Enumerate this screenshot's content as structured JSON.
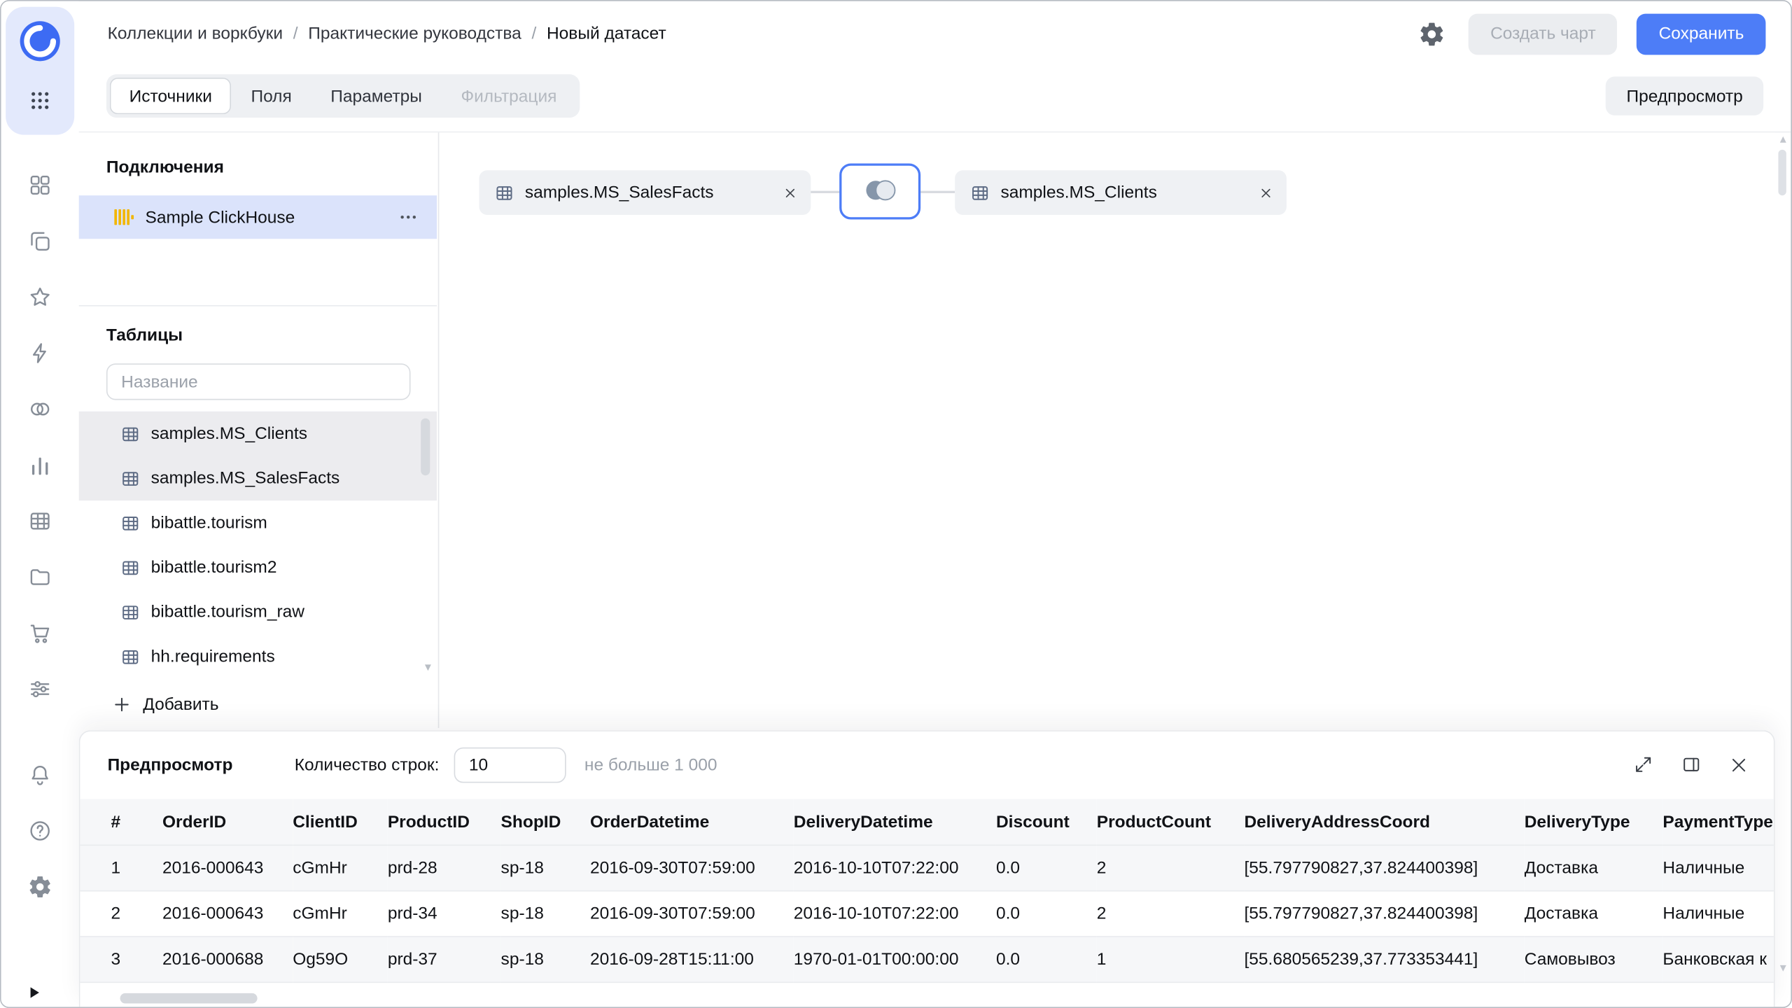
{
  "header": {
    "breadcrumb": [
      "Коллекции и воркбуки",
      "Практические руководства",
      "Новый датасет"
    ],
    "actions": {
      "create_chart": "Создать чарт",
      "save": "Сохранить"
    }
  },
  "toolbar": {
    "tabs": [
      {
        "id": "sources",
        "label": "Источники",
        "state": "active"
      },
      {
        "id": "fields",
        "label": "Поля",
        "state": "normal"
      },
      {
        "id": "parameters",
        "label": "Параметры",
        "state": "normal"
      },
      {
        "id": "filtering",
        "label": "Фильтрация",
        "state": "disabled"
      }
    ],
    "preview_toggle": "Предпросмотр"
  },
  "sidebar": {
    "icons": [
      "datalens-logo",
      "apps-grid",
      "squares",
      "layers",
      "star",
      "bolt",
      "circles",
      "chart",
      "grid",
      "folder",
      "cart",
      "sliders",
      "bell",
      "help",
      "gear",
      "collapse-play"
    ]
  },
  "connections": {
    "title": "Подключения",
    "items": [
      {
        "name": "Sample ClickHouse",
        "selected": true,
        "icon": "clickhouse"
      }
    ]
  },
  "tables": {
    "title": "Таблицы",
    "search_placeholder": "Название",
    "items": [
      {
        "name": "samples.MS_Clients",
        "selected": true
      },
      {
        "name": "samples.MS_SalesFacts",
        "selected": true
      },
      {
        "name": "bibattle.tourism",
        "selected": false
      },
      {
        "name": "bibattle.tourism2",
        "selected": false
      },
      {
        "name": "bibattle.tourism_raw",
        "selected": false
      },
      {
        "name": "hh.requirements",
        "selected": false
      }
    ],
    "add_label": "Добавить"
  },
  "canvas": {
    "nodes": [
      {
        "id": "sales-facts",
        "label": "samples.MS_SalesFacts"
      },
      {
        "id": "clients",
        "label": "samples.MS_Clients"
      }
    ],
    "join_icon": "inner-join-venn-icon"
  },
  "preview": {
    "title": "Предпросмотр",
    "row_count_label": "Количество строк:",
    "row_count_value": "10",
    "row_count_hint": "не больше 1 000",
    "columns": [
      "#",
      "OrderID",
      "ClientID",
      "ProductID",
      "ShopID",
      "OrderDatetime",
      "DeliveryDatetime",
      "Discount",
      "ProductCount",
      "DeliveryAddressCoord",
      "DeliveryType",
      "PaymentType"
    ],
    "rows": [
      [
        "1",
        "2016-000643",
        "cGmHr",
        "prd-28",
        "sp-18",
        "2016-09-30T07:59:00",
        "2016-10-10T07:22:00",
        "0.0",
        "2",
        "[55.797790827,37.824400398]",
        "Доставка",
        "Наличные"
      ],
      [
        "2",
        "2016-000643",
        "cGmHr",
        "prd-34",
        "sp-18",
        "2016-09-30T07:59:00",
        "2016-10-10T07:22:00",
        "0.0",
        "2",
        "[55.797790827,37.824400398]",
        "Доставка",
        "Наличные"
      ],
      [
        "3",
        "2016-000688",
        "Og59O",
        "prd-37",
        "sp-18",
        "2016-09-28T15:11:00",
        "1970-01-01T00:00:00",
        "0.0",
        "1",
        "[55.680565239,37.773353441]",
        "Самовывоз",
        "Банковская к"
      ]
    ]
  },
  "colors": {
    "accent": "#4d7df7",
    "clickhouse_yellow": "#f2b600",
    "selected_connection_bg": "#dbe3fb",
    "selected_table_bg": "#ececef"
  }
}
